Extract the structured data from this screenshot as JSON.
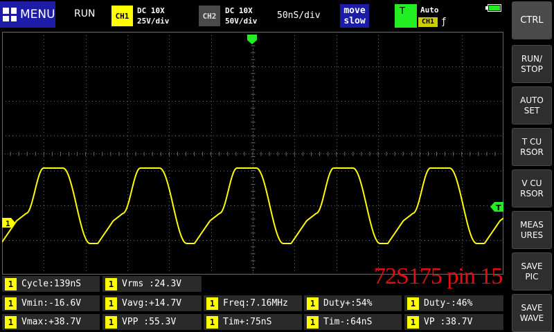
{
  "header": {
    "menu_label": "MENU",
    "run_status": "RUN",
    "ch1": {
      "badge": "CH1",
      "coupling": "DC 10X",
      "scale": "25V/div"
    },
    "ch2": {
      "badge": "CH2",
      "coupling": "DC 10X",
      "scale": "50V/div"
    },
    "timebase": "50nS/div",
    "move_line1": "move",
    "move_line2": "slow",
    "trigger": {
      "badge": "T",
      "mode": "Auto",
      "source": "CH1",
      "edge": "ƒ"
    }
  },
  "plot": {
    "ch1_marker": "1",
    "trigger_level_marker": "T",
    "waveform_color": "#ffff00",
    "grid_color": "#6a6a6a"
  },
  "measurements": [
    {
      "ch": "1",
      "text": "Cycle:139nS"
    },
    {
      "ch": "1",
      "text": "Vrms :24.3V"
    },
    {
      "ch": "1",
      "text": "Vmin:-16.6V"
    },
    {
      "ch": "1",
      "text": "Vavg:+14.7V"
    },
    {
      "ch": "1",
      "text": "Freq:7.16MHz"
    },
    {
      "ch": "1",
      "text": "Duty+:54%"
    },
    {
      "ch": "1",
      "text": "Duty-:46%"
    },
    {
      "ch": "1",
      "text": "Vmax:+38.7V"
    },
    {
      "ch": "1",
      "text": "VPP :55.3V"
    },
    {
      "ch": "1",
      "text": "Tim+:75nS"
    },
    {
      "ch": "1",
      "text": "Tim-:64nS"
    },
    {
      "ch": "1",
      "text": "VP :38.7V"
    }
  ],
  "annotation": "72S175 pin 15",
  "sidebar": [
    {
      "label": "CTRL"
    },
    {
      "label": "RUN/\nSTOP"
    },
    {
      "label": "AUTO\nSET"
    },
    {
      "label": "T CU\nRSOR"
    },
    {
      "label": "V CU\nRSOR"
    },
    {
      "label": "MEAS\nURES"
    },
    {
      "label": "SAVE\nPIC"
    },
    {
      "label": "SAVE\nWAVE"
    }
  ]
}
